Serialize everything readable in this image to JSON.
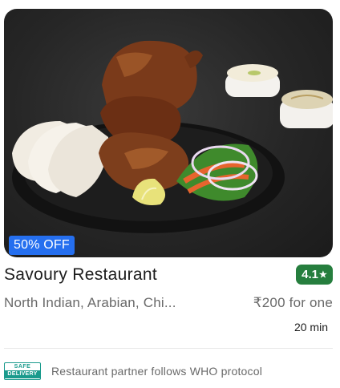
{
  "card": {
    "offer": "50% OFF",
    "name": "Savoury Restaurant",
    "rating": "4.1",
    "rating_icon": "star-icon",
    "cuisines": "North Indian, Arabian, Chi...",
    "price": "₹200 for one",
    "delivery_time": "20 min",
    "safety_logo_top": "SAFE",
    "safety_logo_bottom": "DELIVERY",
    "safety_text": "Restaurant partner follows WHO protocol"
  },
  "colors": {
    "offer_badge": "#256fef",
    "rating_badge": "#267e3e",
    "safe_logo": "#1a9a8c"
  }
}
